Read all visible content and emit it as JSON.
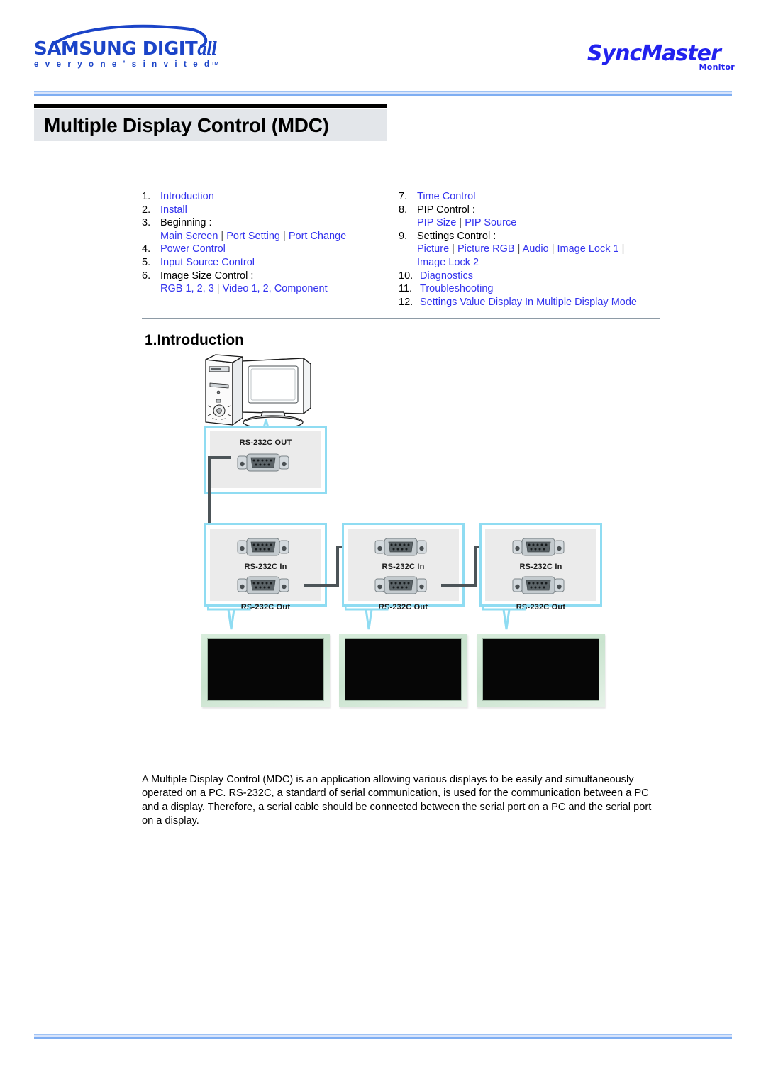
{
  "header": {
    "samsung_logo": {
      "wordmark_main": "SAMSUNG DIGIT",
      "wordmark_italic": "all",
      "tagline": "e v e r y o n e ' s   i n v i t e d",
      "tagline_tm": "TM"
    },
    "syncmaster_logo": {
      "word": "SyncMaster",
      "sub": "Monitor"
    }
  },
  "page": {
    "title": "Multiple Display Control (MDC)",
    "section_heading": "1.Introduction"
  },
  "toc": {
    "left": [
      {
        "num": "1.",
        "text": "Introduction",
        "link": true
      },
      {
        "num": "2.",
        "text": "Install",
        "link": true
      },
      {
        "num": "3.",
        "text": "Beginning :",
        "link": false,
        "sub": [
          "Main Screen",
          "Port Setting",
          "Port Change"
        ]
      },
      {
        "num": "4.",
        "text": "Power Control",
        "link": true
      },
      {
        "num": "5.",
        "text": "Input Source Control",
        "link": true
      },
      {
        "num": "6.",
        "text": "Image Size Control :",
        "link": false,
        "sub": [
          "RGB 1, 2, 3",
          "Video 1, 2, Component"
        ]
      }
    ],
    "right": [
      {
        "num": "7.",
        "text": "Time Control",
        "link": true
      },
      {
        "num": "8.",
        "text": "PIP Control :",
        "link": false,
        "sub": [
          "PIP Size",
          "PIP Source"
        ]
      },
      {
        "num": "9.",
        "text": "Settings Control :",
        "link": false,
        "sub": [
          "Picture",
          "Picture RGB",
          "Audio",
          "Image Lock 1"
        ],
        "sub2": [
          "Image Lock 2"
        ]
      },
      {
        "num": "10.",
        "text": "Diagnostics",
        "link": true
      },
      {
        "num": "11.",
        "text": "Troubleshooting",
        "link": true
      },
      {
        "num": "12.",
        "text": "Settings Value Display In Multiple Display Mode",
        "link": true
      }
    ],
    "separator": "|"
  },
  "diagram": {
    "boxes": [
      {
        "id": "out",
        "labels": [
          "RS-232C OUT"
        ]
      },
      {
        "id": "display1",
        "labels": [
          "RS-232C In",
          "RS-232C Out"
        ]
      },
      {
        "id": "display2",
        "labels": [
          "RS-232C In",
          "RS-232C Out"
        ]
      },
      {
        "id": "display3",
        "labels": [
          "RS-232C In",
          "RS-232C Out"
        ]
      }
    ],
    "label_out": "RS-232C OUT",
    "label_in": "RS-232C In",
    "label_outsm": "RS-232C Out",
    "colors": {
      "box_border": "#8FDCF2",
      "box_fill": "#EBEBEB",
      "cable": "#4C5458",
      "screen": "#060606"
    }
  },
  "body": {
    "paragraph": "A Multiple Display Control (MDC) is an application allowing various displays to be easily and simultaneously operated on a PC. RS-232C, a standard of serial communication, is used for the communication between a PC and a display. Therefore, a serial cable should be connected between the serial port on a PC and the serial port on a display."
  },
  "colors": {
    "link_blue": "#3333EE",
    "brand_blue": "#1B44C8",
    "title_bg": "#E3E6EA",
    "rule_blue": "#9FC3F5"
  }
}
